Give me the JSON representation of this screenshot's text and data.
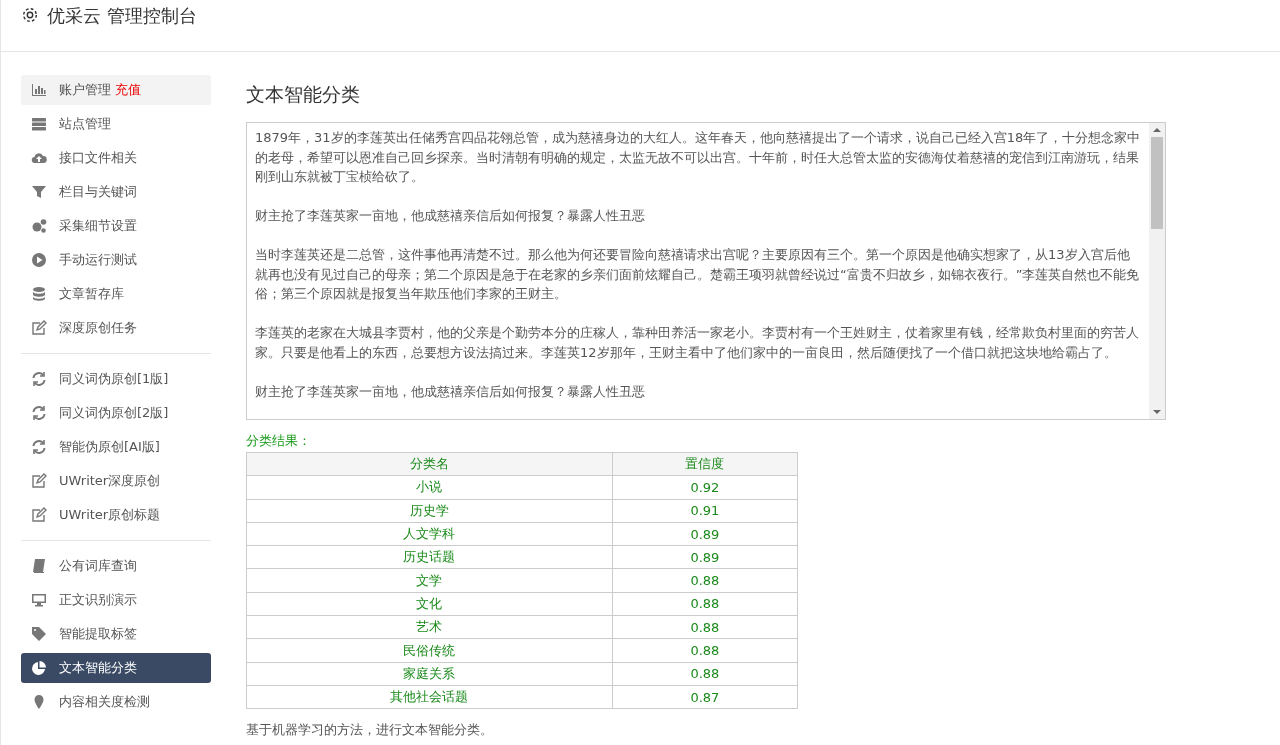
{
  "header": {
    "title": "优采云 管理控制台"
  },
  "sidebar": {
    "groups": [
      [
        {
          "label": "账户管理",
          "badge": "充值",
          "selected": false,
          "hover": true
        },
        {
          "label": "站点管理",
          "selected": false,
          "hover": false
        },
        {
          "label": "接口文件相关",
          "selected": false,
          "hover": false
        },
        {
          "label": "栏目与关键词",
          "selected": false,
          "hover": false
        },
        {
          "label": "采集细节设置",
          "selected": false,
          "hover": false
        },
        {
          "label": "手动运行测试",
          "selected": false,
          "hover": false
        },
        {
          "label": "文章暂存库",
          "selected": false,
          "hover": false
        },
        {
          "label": "深度原创任务",
          "selected": false,
          "hover": false
        }
      ],
      [
        {
          "label": "同义词伪原创[1版]",
          "selected": false,
          "hover": false
        },
        {
          "label": "同义词伪原创[2版]",
          "selected": false,
          "hover": false
        },
        {
          "label": "智能伪原创[AI版]",
          "selected": false,
          "hover": false
        },
        {
          "label": "UWriter深度原创",
          "selected": false,
          "hover": false
        },
        {
          "label": "UWriter原创标题",
          "selected": false,
          "hover": false
        }
      ],
      [
        {
          "label": "公有词库查询",
          "selected": false,
          "hover": false
        },
        {
          "label": "正文识别演示",
          "selected": false,
          "hover": false
        },
        {
          "label": "智能提取标签",
          "selected": false,
          "hover": false
        },
        {
          "label": "文本智能分类",
          "selected": true,
          "hover": false
        },
        {
          "label": "内容相关度检测",
          "selected": false,
          "hover": false
        }
      ]
    ]
  },
  "main": {
    "title": "文本智能分类",
    "text_paragraphs": [
      "1879年，31岁的李莲英出任储秀宫四品花翎总管，成为慈禧身边的大红人。这年春天，他向慈禧提出了一个请求，说自己已经入宫18年了，十分想念家中的老母，希望可以恩准自己回乡探亲。当时清朝有明确的规定，太监无故不可以出宫。十年前，时任大总管太监的安德海仗着慈禧的宠信到江南游玩，结果刚到山东就被丁宝桢给砍了。",
      "财主抢了李莲英家一亩地，他成慈禧亲信后如何报复？暴露人性丑恶",
      "当时李莲英还是二总管，这件事他再清楚不过。那么他为何还要冒险向慈禧请求出宫呢？主要原因有三个。第一个原因是他确实想家了，从13岁入宫后他就再也没有见过自己的母亲；第二个原因是急于在老家的乡亲们面前炫耀自己。楚霸王项羽就曾经说过“富贵不归故乡，如锦衣夜行。”李莲英自然也不能免俗；第三个原因就是报复当年欺压他们李家的王财主。",
      "李莲英的老家在大城县李贾村，他的父亲是个勤劳本分的庄稼人，靠种田养活一家老小。李贾村有一个王姓财主，仗着家里有钱，经常欺负村里面的穷苦人家。只要是他看上的东西，总要想方设法搞过来。李莲英12岁那年，王财主看中了他们家中的一亩良田，然后随便找了一个借口就把这块地给霸占了。",
      "财主抢了李莲英家一亩地，他成慈禧亲信后如何报复？暴露人性丑恶"
    ],
    "result_label": "分类结果：",
    "table": {
      "columns": [
        "分类名",
        "置信度"
      ],
      "rows": [
        [
          "小说",
          "0.92"
        ],
        [
          "历史学",
          "0.91"
        ],
        [
          "人文学科",
          "0.89"
        ],
        [
          "历史话题",
          "0.89"
        ],
        [
          "文学",
          "0.88"
        ],
        [
          "文化",
          "0.88"
        ],
        [
          "艺术",
          "0.88"
        ],
        [
          "民俗传统",
          "0.88"
        ],
        [
          "家庭关系",
          "0.88"
        ],
        [
          "其他社会话题",
          "0.87"
        ]
      ]
    },
    "footnote": "基于机器学习的方法，进行文本智能分类。"
  }
}
